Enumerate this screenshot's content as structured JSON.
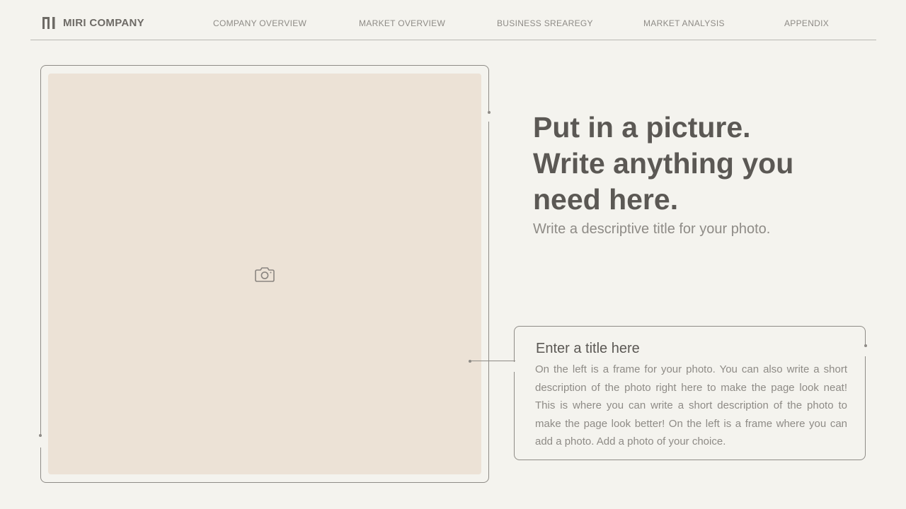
{
  "header": {
    "brand": "MIRI COMPANY",
    "logo_icon": "miri-logo-icon",
    "nav": [
      "COMPANY OVERVIEW",
      "MARKET OVERVIEW",
      "BUSINESS SREAREGY",
      "MARKET ANALYSIS",
      "APPENDIX"
    ]
  },
  "photo": {
    "icon": "camera-icon"
  },
  "headline": {
    "line1": "Put in a picture.",
    "line2": "Write anything you",
    "line3": "need here."
  },
  "subtitle": "Write a descriptive title for your photo.",
  "card": {
    "title": "Enter a title here",
    "body": "On the left is a frame for your photo. You can also write a short description of the photo right here to make the page look neat! This is where you can write a short description of the photo to make the page look better! On the left is a frame where you can add a photo. Add a photo of your choice."
  },
  "colors": {
    "background": "#f4f3ee",
    "photo_placeholder": "#ece2d6",
    "text_dark": "#5b5854",
    "text_muted": "#8e8b86"
  }
}
